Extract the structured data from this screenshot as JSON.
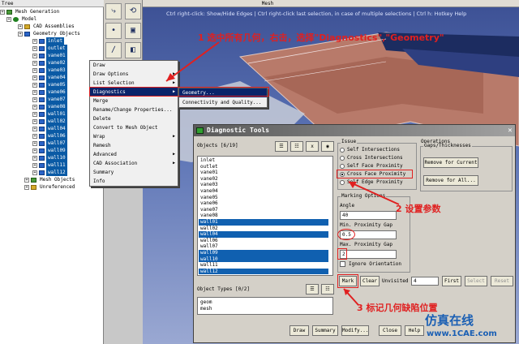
{
  "tree": {
    "panel_title": "Tree",
    "items": [
      {
        "label": "Mesh Generation",
        "icon": "mesh-icon",
        "selected": false
      },
      {
        "label": "Model",
        "icon": "sphere-icon",
        "selected": false
      },
      {
        "label": "CAD Assemblies",
        "icon": "folder-icon",
        "selected": false
      },
      {
        "label": "Geometry Objects",
        "icon": "geometry-icon",
        "selected": false
      },
      {
        "label": "inlet",
        "selected": true
      },
      {
        "label": "outlet",
        "selected": true
      },
      {
        "label": "vane01",
        "selected": true
      },
      {
        "label": "vane02",
        "selected": true
      },
      {
        "label": "vane03",
        "selected": true
      },
      {
        "label": "vane04",
        "selected": true
      },
      {
        "label": "vane05",
        "selected": true
      },
      {
        "label": "vane06",
        "selected": true
      },
      {
        "label": "vane07",
        "selected": true
      },
      {
        "label": "vane08",
        "selected": true
      },
      {
        "label": "wall01",
        "selected": true
      },
      {
        "label": "wall02",
        "selected": true
      },
      {
        "label": "wall04",
        "selected": true
      },
      {
        "label": "wall06",
        "selected": true
      },
      {
        "label": "wall07",
        "selected": true
      },
      {
        "label": "wall09",
        "selected": true
      },
      {
        "label": "wall10",
        "selected": true
      },
      {
        "label": "wall11",
        "selected": true
      },
      {
        "label": "wall12",
        "selected": true
      },
      {
        "label": "Mesh Objects",
        "icon": "mesh-icon",
        "selected": false
      },
      {
        "label": "Unreferenced",
        "icon": "folder-icon",
        "selected": false
      }
    ]
  },
  "viewport": {
    "title": "Mesh",
    "hint": "Ctrl right-click: Show/Hide Edges | Ctrl right-click last selection, in case of multiple selections | Ctrl h: Hotkey Help"
  },
  "context_menu": {
    "items": [
      "Draw",
      "Draw Options",
      "List Selection",
      "Diagnostics",
      "Merge",
      "Rename/Change Properties...",
      "Delete",
      "Convert to Mesh Object",
      "Wrap",
      "Remesh",
      "Advanced",
      "CAD Association",
      "Summary",
      "Info"
    ],
    "submenu_items": [
      "Geometry...",
      "Connectivity and Quality..."
    ]
  },
  "annotations": {
    "step1": "1 选中所有几何，右击，选择\"Diagnostics\",\"Geometry\"",
    "step2": "2 设置参数",
    "step3": "3 标记几何缺陷位置"
  },
  "dialog": {
    "title": "Diagnostic Tools",
    "objects_label": "Objects [6/19]",
    "objects": [
      {
        "name": "inlet",
        "selected": false
      },
      {
        "name": "outlet",
        "selected": false
      },
      {
        "name": "vane01",
        "selected": false
      },
      {
        "name": "vane02",
        "selected": false
      },
      {
        "name": "vane03",
        "selected": false
      },
      {
        "name": "vane04",
        "selected": false
      },
      {
        "name": "vane05",
        "selected": false
      },
      {
        "name": "vane06",
        "selected": false
      },
      {
        "name": "vane07",
        "selected": false
      },
      {
        "name": "vane08",
        "selected": false
      },
      {
        "name": "wall01",
        "selected": true
      },
      {
        "name": "wall02",
        "selected": false
      },
      {
        "name": "wall04",
        "selected": true
      },
      {
        "name": "wall06",
        "selected": false
      },
      {
        "name": "wall07",
        "selected": false
      },
      {
        "name": "wall09",
        "selected": true
      },
      {
        "name": "wall10",
        "selected": true
      },
      {
        "name": "wall11",
        "selected": false
      },
      {
        "name": "wall12",
        "selected": true
      }
    ],
    "object_types_label": "Object Types [0/2]",
    "object_types": [
      "geom",
      "mesh"
    ],
    "issue_title": "Issue",
    "issues": [
      {
        "label": "Self Intersections",
        "checked": false
      },
      {
        "label": "Cross Intersections",
        "checked": false
      },
      {
        "label": "Self Face Proximity",
        "checked": false
      },
      {
        "label": "Cross Face Proximity",
        "checked": true
      },
      {
        "label": "Self Edge Proximity",
        "checked": false
      }
    ],
    "operations_title": "Operations",
    "gaps_title": "Gaps/Thicknesses",
    "remove_current": "Remove for Current",
    "remove_all": "Remove for All...",
    "marking_title": "Marking Options",
    "angle_label": "Angle",
    "angle_value": "40",
    "min_gap_label": "Min. Proximity Gap",
    "min_gap_value": "0.5",
    "max_gap_label": "Max. Proximity Gap",
    "max_gap_value": "2",
    "ignore_orientation": "Ignore Orientation",
    "mark": "Mark",
    "clear": "Clear",
    "unvisited_label": "Unvisited",
    "unvisited_value": "4",
    "first": "First",
    "select": "Select",
    "reset": "Reset",
    "bottom_buttons": [
      "Draw",
      "Summary",
      "Modify...",
      "Close",
      "Help"
    ]
  },
  "watermark": {
    "line1": "仿真在线",
    "line2": "www.1CAE.com"
  },
  "colors": {
    "selection": "#0a5aa5",
    "annotation": "#e02020",
    "viewport_bg": "#4a62a8"
  }
}
